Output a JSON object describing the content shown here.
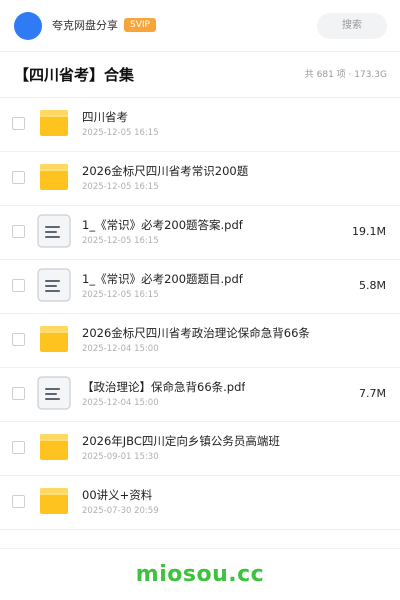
{
  "header": {
    "share_name": "夸克网盘分享",
    "badge": "SVIP",
    "search_label": "搜索",
    "avatar_color": "#2f7bf6",
    "badge_color": "#f7a53a"
  },
  "folder": {
    "title": "【四川省考】合集",
    "summary": "共 681 项 · 173.3G"
  },
  "files": [
    {
      "name": "四川省考",
      "date": "2025-12-05 16:15",
      "size": "",
      "type": "folder"
    },
    {
      "name": "2026金标尺四川省考常识200题",
      "date": "2025-12-05 16:15",
      "size": "",
      "type": "folder"
    },
    {
      "name": "1_《常识》必考200题答案.pdf",
      "date": "2025-12-05 16:15",
      "size": "19.1M",
      "type": "document"
    },
    {
      "name": "1_《常识》必考200题题目.pdf",
      "date": "2025-12-05 16:15",
      "size": "5.8M",
      "type": "document"
    },
    {
      "name": "2026金标尺四川省考政治理论保命急背66条",
      "date": "2025-12-04 15:00",
      "size": "",
      "type": "folder"
    },
    {
      "name": "【政治理论】保命急背66条.pdf",
      "date": "2025-12-04 15:00",
      "size": "7.7M",
      "type": "document"
    },
    {
      "name": "2026年JBC四川定向乡镇公务员高端班",
      "date": "2025-09-01 15:30",
      "size": "",
      "type": "folder"
    },
    {
      "name": "00讲义+资料",
      "date": "2025-07-30 20:59",
      "size": "",
      "type": "folder"
    }
  ],
  "footer": {
    "watermark": "miosou.cc",
    "watermark_color": "#3cc23c"
  }
}
